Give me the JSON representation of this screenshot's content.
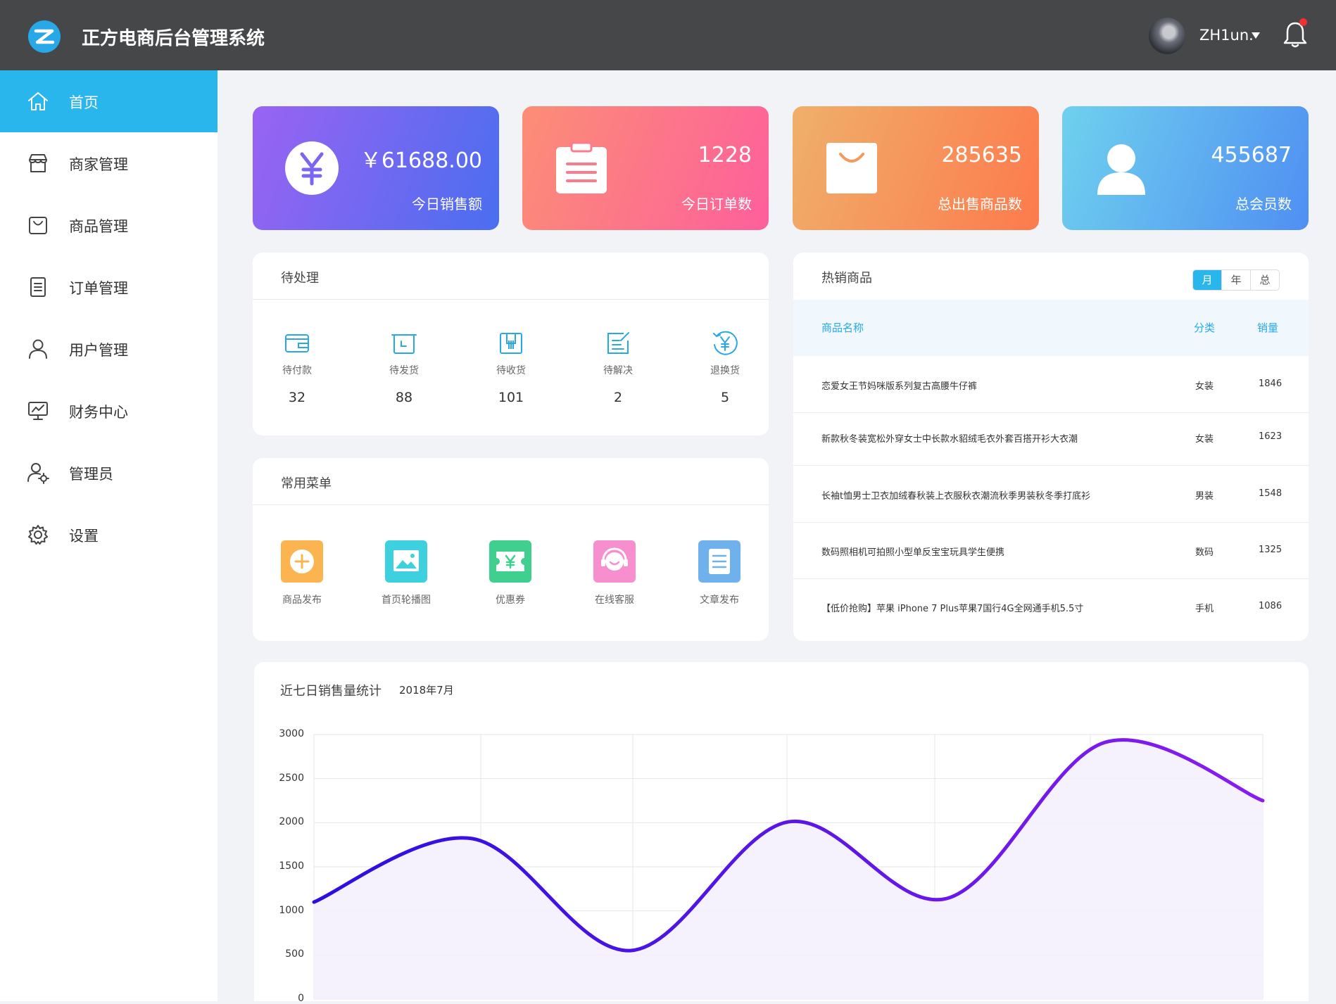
{
  "app": {
    "title": "正方电商后台管理系统"
  },
  "user": {
    "name": "ZH1un."
  },
  "sidebar": {
    "items": [
      {
        "label": "首页",
        "icon": "home-icon",
        "active": true
      },
      {
        "label": "商家管理",
        "icon": "store-icon"
      },
      {
        "label": "商品管理",
        "icon": "bag-icon"
      },
      {
        "label": "订单管理",
        "icon": "order-icon"
      },
      {
        "label": "用户管理",
        "icon": "user-icon"
      },
      {
        "label": "财务中心",
        "icon": "finance-icon"
      },
      {
        "label": "管理员",
        "icon": "admin-icon"
      },
      {
        "label": "设置",
        "icon": "gear-icon"
      }
    ]
  },
  "stats": [
    {
      "value": "￥61688.00",
      "label": "今日销售额",
      "icon": "yen-icon"
    },
    {
      "value": "1228",
      "label": "今日订单数",
      "icon": "clipboard-icon"
    },
    {
      "value": "285635",
      "label": "总出售商品数",
      "icon": "shopping-bag-icon"
    },
    {
      "value": "455687",
      "label": "总会员数",
      "icon": "member-icon"
    }
  ],
  "pending": {
    "title": "待处理",
    "items": [
      {
        "label": "待付款",
        "count": "32",
        "icon": "wallet-icon"
      },
      {
        "label": "待发货",
        "count": "88",
        "icon": "box-icon"
      },
      {
        "label": "待收货",
        "count": "101",
        "icon": "package-icon"
      },
      {
        "label": "待解决",
        "count": "2",
        "icon": "edit-icon"
      },
      {
        "label": "退换货",
        "count": "5",
        "icon": "refund-icon"
      }
    ]
  },
  "menu": {
    "title": "常用菜单",
    "items": [
      {
        "label": "商品发布",
        "icon": "plus-icon",
        "color": "#fcb450"
      },
      {
        "label": "首页轮播图",
        "icon": "image-icon",
        "color": "#3dd1e0"
      },
      {
        "label": "优惠券",
        "icon": "coupon-icon",
        "color": "#3fd08f"
      },
      {
        "label": "在线客服",
        "icon": "headset-icon",
        "color": "#f78fcf"
      },
      {
        "label": "文章发布",
        "icon": "document-icon",
        "color": "#6fb1ed"
      }
    ]
  },
  "hot": {
    "title": "热销商品",
    "tabs": [
      "月",
      "年",
      "总"
    ],
    "active_tab": "月",
    "columns": [
      "商品名称",
      "分类",
      "销量"
    ],
    "rows": [
      {
        "name": "恋爱女王节妈咪版系列复古高腰牛仔裤",
        "category": "女装",
        "sales": "1846"
      },
      {
        "name": "新款秋冬装宽松外穿女士中长款水貂绒毛衣外套百搭开衫大衣潮",
        "category": "女装",
        "sales": "1623"
      },
      {
        "name": "长袖t恤男士卫衣加绒春秋装上衣服秋衣潮流秋季男装秋冬季打底衫",
        "category": "男装",
        "sales": "1548"
      },
      {
        "name": "数码照相机可拍照小型单反宝宝玩具学生便携",
        "category": "数码",
        "sales": "1325"
      },
      {
        "name": "【低价抢购】苹果 iPhone 7 Plus苹果7国行4G全网通手机5.5寸",
        "category": "手机",
        "sales": "1086"
      }
    ]
  },
  "chart": {
    "title": "近七日销售量统计",
    "date": "2018年7月"
  },
  "chart_data": {
    "type": "line",
    "title": "近七日销售量统计",
    "subtitle": "2018年7月",
    "ylim": [
      0,
      3000
    ],
    "yticks": [
      3000,
      2500,
      2000,
      1500,
      1000,
      500,
      0
    ],
    "x": [
      1,
      2,
      3,
      4,
      5,
      6,
      7
    ],
    "values": [
      1100,
      1820,
      550,
      2010,
      1140,
      2910,
      2250
    ],
    "smooth": true,
    "grid": true,
    "colors": {
      "line_start": "#2a0fe0",
      "line_end": "#8a1cf0",
      "fill": "#f3effd"
    }
  },
  "colors": {
    "accent": "#29b6ec",
    "topbar": "#464749"
  }
}
